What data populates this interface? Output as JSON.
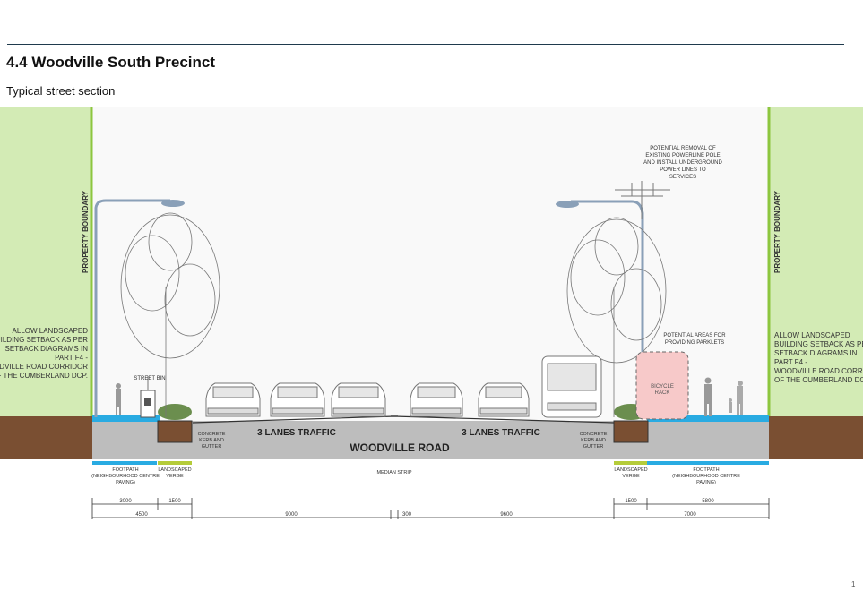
{
  "header": {
    "title": "4.4 Woodville South Precinct",
    "subtitle": "Typical street section",
    "page_number": "1"
  },
  "section": {
    "property_boundary_left": "PROPERTY BOUNDARY",
    "property_boundary_right": "PROPERTY BOUNDARY",
    "setback_note_left": [
      "ALLOW LANDSCAPED",
      "BUILDING SETBACK AS PER",
      "SETBACK DIAGRAMS IN",
      "PART F4 -",
      "WOODVILLE ROAD CORRIDOR",
      "OF THE CUMBERLAND DCP."
    ],
    "setback_note_right": [
      "ALLOW LANDSCAPED",
      "BUILDING SETBACK AS PER",
      "SETBACK DIAGRAMS IN",
      "PART F4 -",
      "WOODVILLE ROAD CORRIDOR",
      "OF THE CUMBERLAND DCP."
    ],
    "powerline_note": [
      "POTENTIAL REMOVAL OF",
      "EXISTING POWERLINE POLE",
      "AND INSTALL UNDERGROUND",
      "POWER LINES TO",
      "SERVICES"
    ],
    "parklet_note": [
      "POTENTIAL AREAS FOR",
      "PROVIDING PARKLETS"
    ],
    "street_bin": "STREET BIN",
    "bicycle_rack": [
      "BICYCLE",
      "RACK"
    ],
    "kerb_left": [
      "CONCRETE",
      "KERB AND",
      "GUTTER"
    ],
    "kerb_right": [
      "CONCRETE",
      "KERB AND",
      "GUTTER"
    ],
    "traffic_left": "3 LANES TRAFFIC",
    "traffic_right": "3 LANES TRAFFIC",
    "road_name": "WOODVILLE ROAD"
  },
  "legend": {
    "footpath_left": [
      "FOOTPATH",
      "(NEIGHBOURHOOD CENTRE",
      "PAVING)"
    ],
    "verge_left": [
      "LANDSCAPED",
      "VERGE"
    ],
    "median": "MEDIAN STRIP",
    "verge_right": [
      "LANDSCAPED",
      "VERGE"
    ],
    "footpath_right": [
      "FOOTPATH",
      "(NEIGHBOURHOOD CENTRE",
      "PAVING)"
    ]
  },
  "dimensions": {
    "row1": [
      "3000",
      "1500",
      "1500",
      "5800"
    ],
    "row2": [
      "4500",
      "9000",
      "300",
      "9600",
      "7000"
    ]
  },
  "colors": {
    "landscape_green": "#d3ebb5",
    "green_border": "#8dc63f",
    "soil": "#7a4f32",
    "road_grey": "#bdbdbd",
    "footpath_blue": "#29abe2",
    "verge_green": "#b5cc3a",
    "parklet_pink": "#f7c9c9"
  }
}
